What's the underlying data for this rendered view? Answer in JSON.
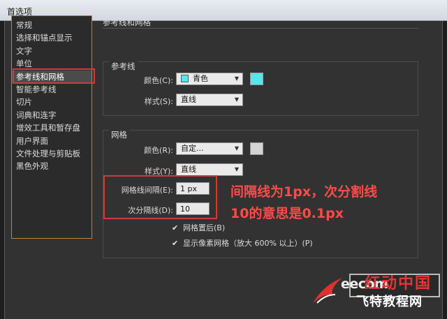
{
  "window": {
    "title": "首选项"
  },
  "sidebar": {
    "items": [
      {
        "label": "常规"
      },
      {
        "label": "选择和锚点显示"
      },
      {
        "label": "文字"
      },
      {
        "label": "单位"
      },
      {
        "label": "参考线和网格",
        "selected": true
      },
      {
        "label": "智能参考线"
      },
      {
        "label": "切片"
      },
      {
        "label": "词典和连字"
      },
      {
        "label": "增效工具和暂存盘"
      },
      {
        "label": "用户界面"
      },
      {
        "label": "文件处理与剪贴板"
      },
      {
        "label": "黑色外观"
      }
    ]
  },
  "panel": {
    "title": "参考线和网格",
    "guides": {
      "label": "参考线",
      "color_label": "颜色(C):",
      "color_value": "青色",
      "color_swatch": "#55e6ee",
      "style_label": "样式(S):",
      "style_value": "直线"
    },
    "grid": {
      "label": "网格",
      "color_label": "颜色(R):",
      "color_value": "自定...",
      "color_swatch": "#d4d4d4",
      "style_label": "样式(Y):",
      "style_value": "直线",
      "gridline_label": "网格线间隔(E):",
      "gridline_value": "1 px",
      "subdiv_label": "次分隔线(D):",
      "subdiv_value": "10",
      "grids_in_back_label": "网格置后(B)",
      "grids_in_back_checked": true,
      "show_pixel_grid_label": "显示像素网格（放大 600% 以上）(P)",
      "show_pixel_grid_checked": true
    }
  },
  "annotation": {
    "line1": "间隔线为1px，次分割线",
    "line2": "10的意思是0.1px",
    "color": "#ff4a4a"
  },
  "watermark": {
    "text_en": "eecom",
    "text_cn_top": "红动中国",
    "text_cn_bottom": "飞特教程网"
  },
  "icons": {
    "checkmark": "✔",
    "dropdown": "▼"
  }
}
